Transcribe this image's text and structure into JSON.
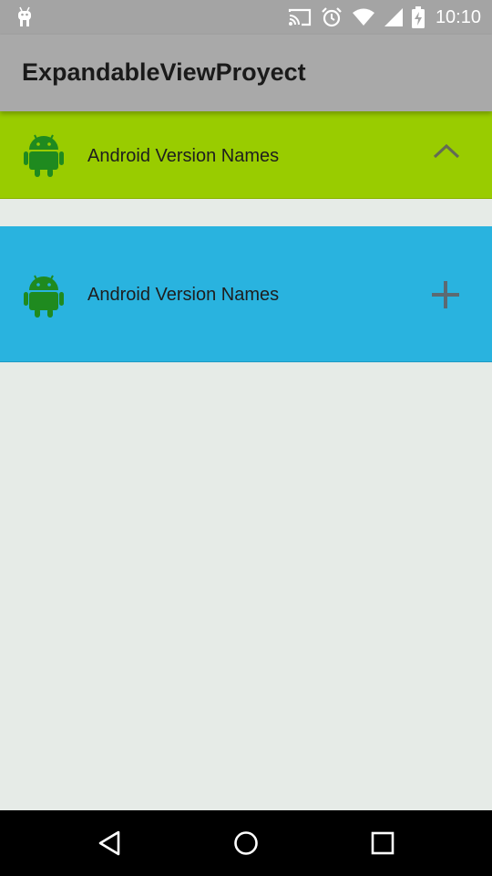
{
  "status_bar": {
    "time": "10:10",
    "icons": [
      "android-notification-icon",
      "cast-icon",
      "alarm-icon",
      "wifi-icon",
      "signal-icon",
      "battery-charging-icon"
    ]
  },
  "app_bar": {
    "title": "ExpandableViewProyect"
  },
  "groups": [
    {
      "label": "Android Version Names",
      "icon": "android-robot-icon",
      "toggle_icon": "chevron-up-icon",
      "background": "#99cc00",
      "expanded": true
    },
    {
      "label": "Android Version Names",
      "icon": "android-robot-icon",
      "toggle_icon": "plus-icon",
      "background": "#29b3df",
      "expanded": false
    }
  ],
  "nav_bar": {
    "icons": [
      "back-icon",
      "home-icon",
      "recents-icon"
    ]
  },
  "colors": {
    "status_bar": "#a4a4a4",
    "app_bar": "#a9a9a9",
    "background": "#e6ebe7",
    "android_green": "#1f8a1f"
  }
}
